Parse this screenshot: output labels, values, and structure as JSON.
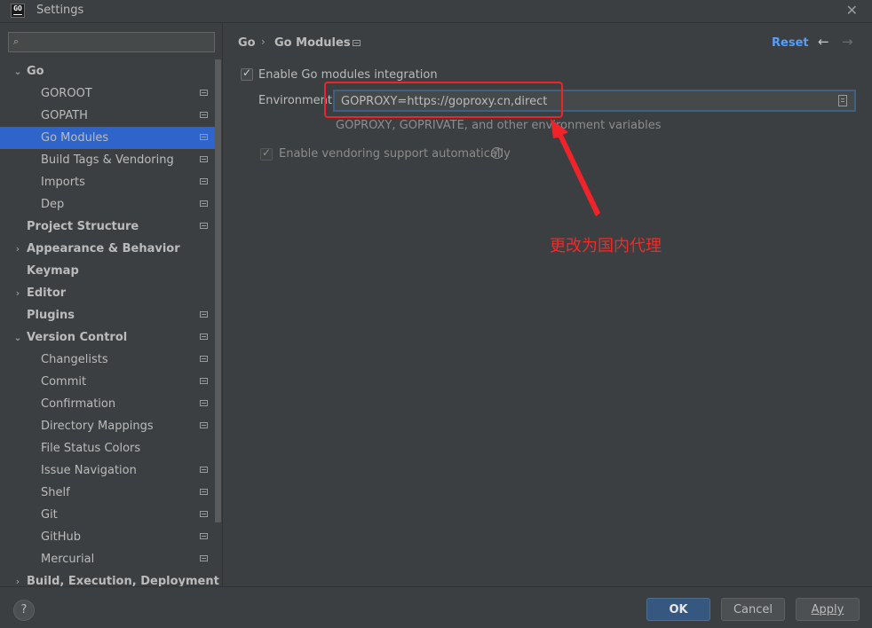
{
  "window": {
    "title": "Settings",
    "logo_text": "GO"
  },
  "search": {
    "placeholder": "",
    "value": ""
  },
  "sidebar": {
    "items": [
      {
        "label": "Go",
        "level": 0,
        "arrow": "⌄",
        "bold": true,
        "page_icon": false,
        "selected": false
      },
      {
        "label": "GOROOT",
        "level": 1,
        "arrow": "",
        "bold": false,
        "page_icon": true,
        "selected": false
      },
      {
        "label": "GOPATH",
        "level": 1,
        "arrow": "",
        "bold": false,
        "page_icon": true,
        "selected": false
      },
      {
        "label": "Go Modules",
        "level": 1,
        "arrow": "",
        "bold": false,
        "page_icon": true,
        "selected": true
      },
      {
        "label": "Build Tags & Vendoring",
        "level": 1,
        "arrow": "",
        "bold": false,
        "page_icon": true,
        "selected": false
      },
      {
        "label": "Imports",
        "level": 1,
        "arrow": "",
        "bold": false,
        "page_icon": true,
        "selected": false
      },
      {
        "label": "Dep",
        "level": 1,
        "arrow": "",
        "bold": false,
        "page_icon": true,
        "selected": false
      },
      {
        "label": "Project Structure",
        "level": 0,
        "arrow": "",
        "bold": true,
        "page_icon": true,
        "selected": false
      },
      {
        "label": "Appearance & Behavior",
        "level": 0,
        "arrow": "›",
        "bold": true,
        "page_icon": false,
        "selected": false
      },
      {
        "label": "Keymap",
        "level": 0,
        "arrow": "",
        "bold": true,
        "page_icon": false,
        "selected": false
      },
      {
        "label": "Editor",
        "level": 0,
        "arrow": "›",
        "bold": true,
        "page_icon": false,
        "selected": false
      },
      {
        "label": "Plugins",
        "level": 0,
        "arrow": "",
        "bold": true,
        "page_icon": true,
        "selected": false
      },
      {
        "label": "Version Control",
        "level": 0,
        "arrow": "⌄",
        "bold": true,
        "page_icon": true,
        "selected": false
      },
      {
        "label": "Changelists",
        "level": 1,
        "arrow": "",
        "bold": false,
        "page_icon": true,
        "selected": false
      },
      {
        "label": "Commit",
        "level": 1,
        "arrow": "",
        "bold": false,
        "page_icon": true,
        "selected": false
      },
      {
        "label": "Confirmation",
        "level": 1,
        "arrow": "",
        "bold": false,
        "page_icon": true,
        "selected": false
      },
      {
        "label": "Directory Mappings",
        "level": 1,
        "arrow": "",
        "bold": false,
        "page_icon": true,
        "selected": false
      },
      {
        "label": "File Status Colors",
        "level": 1,
        "arrow": "",
        "bold": false,
        "page_icon": false,
        "selected": false
      },
      {
        "label": "Issue Navigation",
        "level": 1,
        "arrow": "",
        "bold": false,
        "page_icon": true,
        "selected": false
      },
      {
        "label": "Shelf",
        "level": 1,
        "arrow": "",
        "bold": false,
        "page_icon": true,
        "selected": false
      },
      {
        "label": "Git",
        "level": 1,
        "arrow": "",
        "bold": false,
        "page_icon": true,
        "selected": false
      },
      {
        "label": "GitHub",
        "level": 1,
        "arrow": "",
        "bold": false,
        "page_icon": true,
        "selected": false
      },
      {
        "label": "Mercurial",
        "level": 1,
        "arrow": "",
        "bold": false,
        "page_icon": true,
        "selected": false
      },
      {
        "label": "Build, Execution, Deployment",
        "level": 0,
        "arrow": "›",
        "bold": true,
        "page_icon": false,
        "selected": false
      }
    ]
  },
  "header": {
    "breadcrumb_root": "Go",
    "breadcrumb_separator": "›",
    "breadcrumb_page": "Go Modules",
    "reset_label": "Reset",
    "back_icon": "←",
    "forward_icon": "→"
  },
  "content": {
    "enable_modules": {
      "label": "Enable Go modules integration",
      "checked": true
    },
    "environment": {
      "label": "Environment",
      "value": "GOPROXY=https://goproxy.cn,direct",
      "hint": "GOPROXY, GOPRIVATE, and other environment variables"
    },
    "vendoring": {
      "label": "Enable vendoring support automatically",
      "checked": true,
      "enabled": false,
      "help_icon": "?"
    }
  },
  "annotation": {
    "text": "更改为国内代理",
    "color": "#f02a2a"
  },
  "footer": {
    "help_label": "?",
    "ok_label": "OK",
    "cancel_label": "Cancel",
    "apply_label": "Apply"
  },
  "colors": {
    "selection": "#2f65ca",
    "link": "#589df6",
    "primary_button": "#365880",
    "background": "#3c3f41"
  }
}
